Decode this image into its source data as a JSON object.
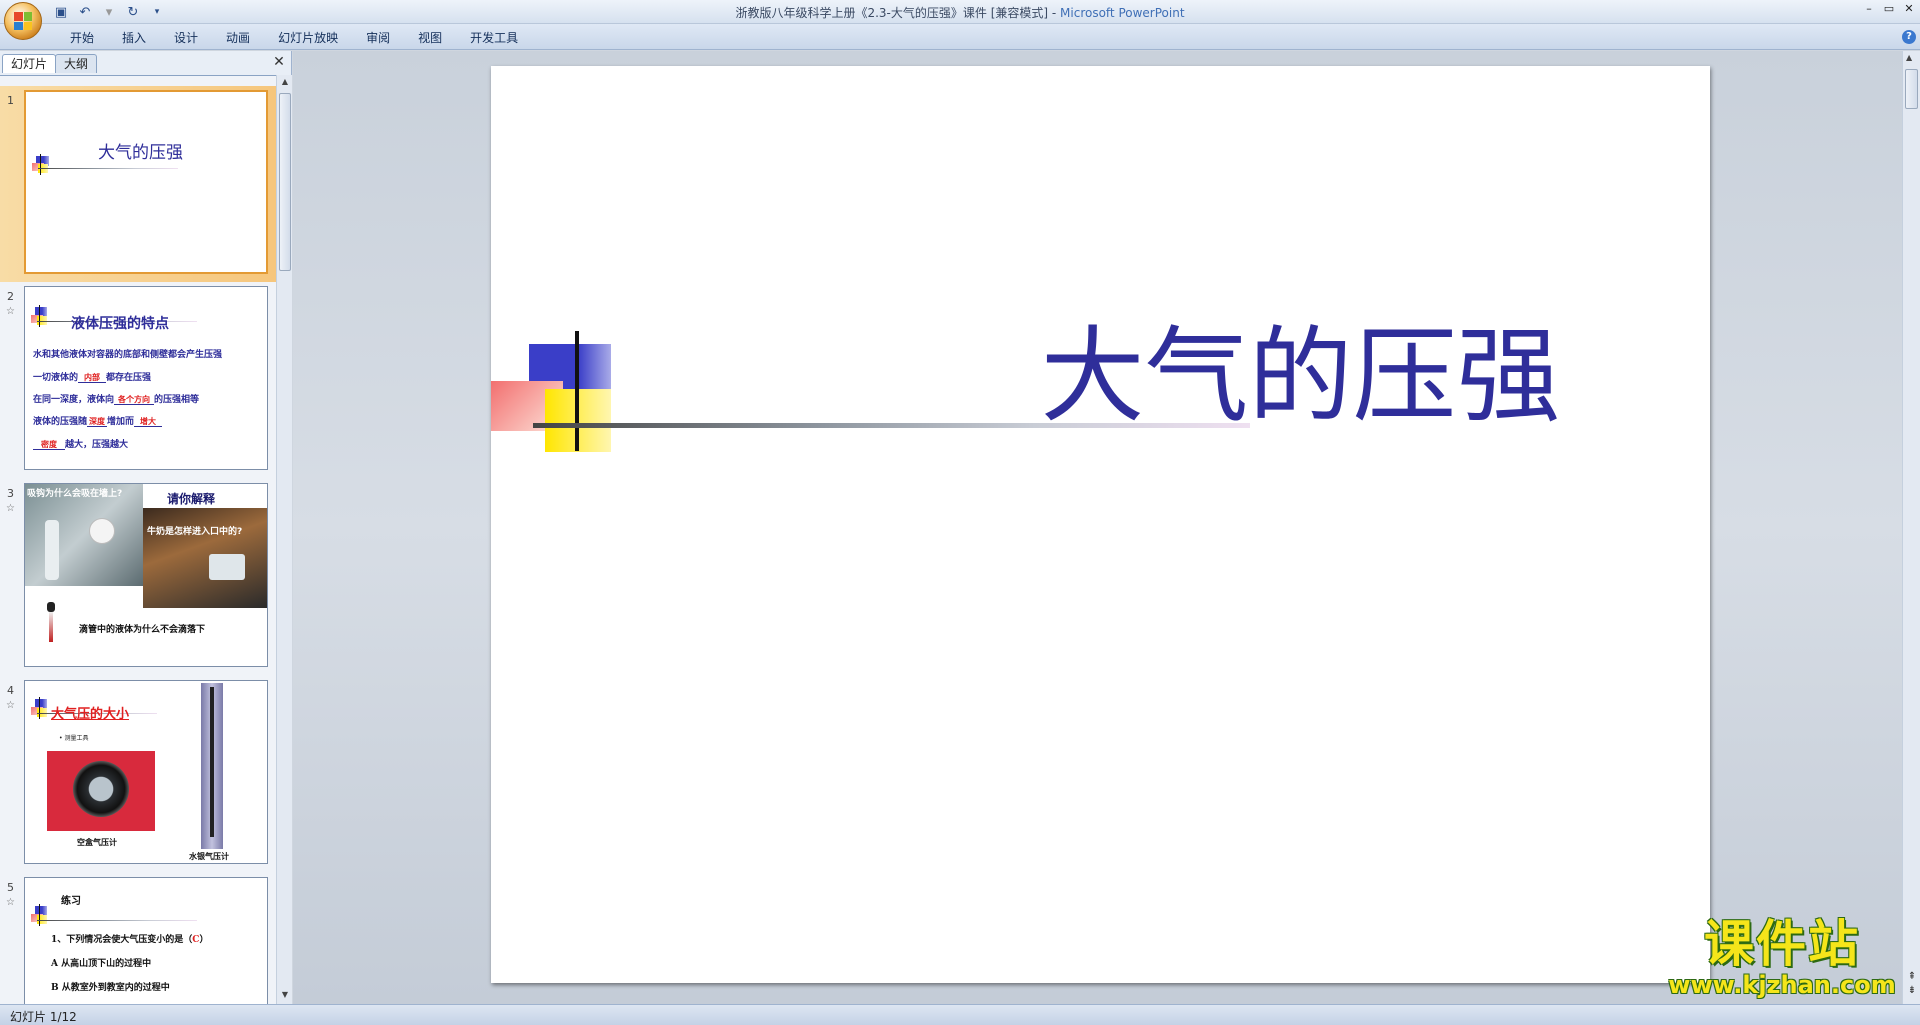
{
  "window": {
    "title": "浙教版八年级科学上册《2.3-大气的压强》课件 [兼容模式] - ",
    "app_name": "Microsoft PowerPoint"
  },
  "ribbon": {
    "tabs": [
      "开始",
      "插入",
      "设计",
      "动画",
      "幻灯片放映",
      "审阅",
      "视图",
      "开发工具"
    ]
  },
  "left_pane": {
    "tabs": [
      "幻灯片",
      "大纲"
    ],
    "active_tab": "幻灯片",
    "slides": [
      {
        "number": "1",
        "title": "大气的压强"
      },
      {
        "number": "2",
        "title": "液体压强的特点",
        "lines": [
          "水和其他液体对容器的底部和侧壁都会产生压强",
          "一切液体的",
          "内部",
          "都存在压强",
          "在同一深度，液体向",
          "各个方向",
          "的压强相等",
          "液体的压强随",
          "深度",
          "增加而",
          "增大",
          "密度",
          "越大，压强越大"
        ]
      },
      {
        "number": "3",
        "caption_top": "吸钩为什么会吸在墙上?",
        "title": "请你解释",
        "caption_mid": "牛奶是怎样进入口中的?",
        "caption_bottom": "滴管中的液体为什么不会滴落下"
      },
      {
        "number": "4",
        "title": "大气压的大小",
        "bullet": "测量工具",
        "label_left": "空盒气压计",
        "label_right": "水银气压计"
      },
      {
        "number": "5",
        "title": "练习",
        "q1": "1、下列情况会使大气压变小的是（",
        "q1_answer": "C",
        "q1_end": "）",
        "optA": "A 从高山顶下山的过程中",
        "optB": "B 从教室外到教室内的过程中"
      }
    ]
  },
  "main_slide": {
    "title": "大气的压强"
  },
  "status": {
    "slide_info": "幻灯片 1/12"
  },
  "watermark": {
    "text": "课件站",
    "url": "www.kjzhan.com"
  },
  "colors": {
    "title_blue": "#2f2e9a",
    "accent_orange": "#e39a34",
    "red_text": "#e02020"
  }
}
